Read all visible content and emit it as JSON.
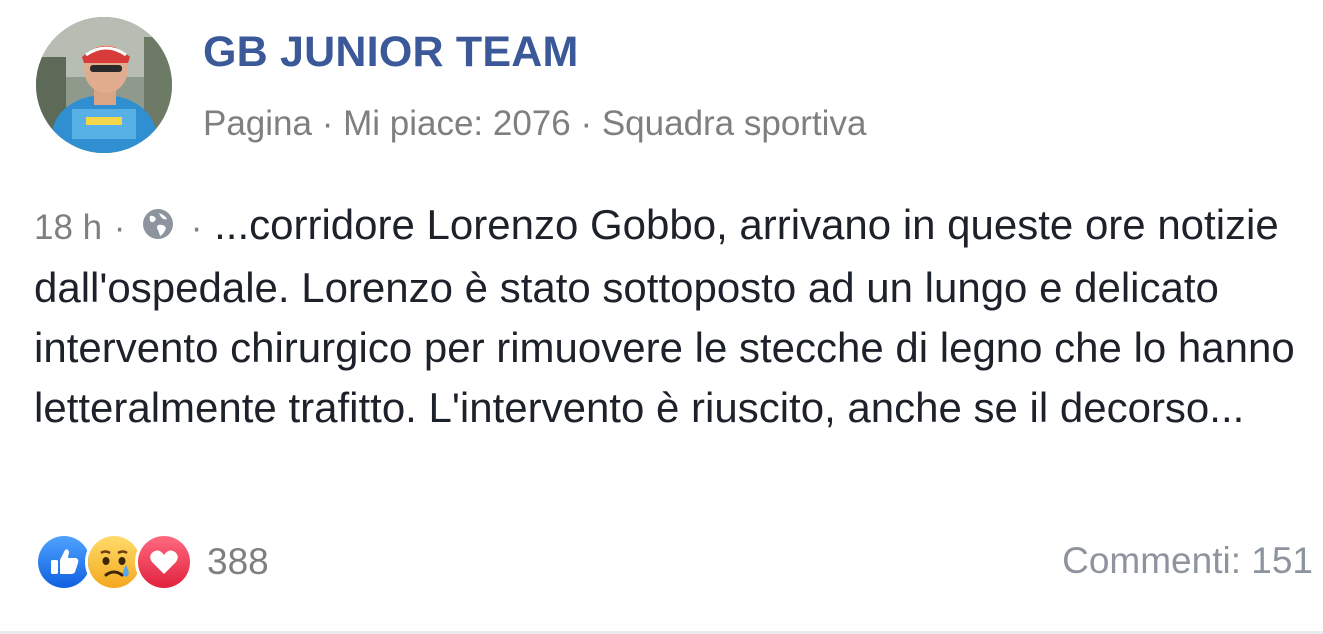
{
  "page": {
    "name": "GB JUNIOR TEAM",
    "meta": "Pagina · Mi piace: 2076 · Squadra sportiva"
  },
  "post": {
    "timestamp": "18 h",
    "separator": "·",
    "privacy_icon": "globe-icon",
    "text": "...corridore Lorenzo Gobbo, arrivano in queste ore notizie dall'ospedale. Lorenzo è stato sottoposto ad un lungo e delicato intervento chirurgico per rimuovere le stecche di legno che lo hanno letteralmente trafitto. L'intervento è riuscito, anche se il decorso..."
  },
  "reactions": {
    "icons": [
      "like-icon",
      "sad-icon",
      "love-icon"
    ],
    "count": "388"
  },
  "comments": {
    "label": "Commenti: 151"
  },
  "colors": {
    "brand": "#3b5998",
    "muted": "#7f7f7f",
    "text": "#1d2129",
    "like": "#1877f2",
    "love": "#f33e58",
    "sad": "#f7b125"
  }
}
